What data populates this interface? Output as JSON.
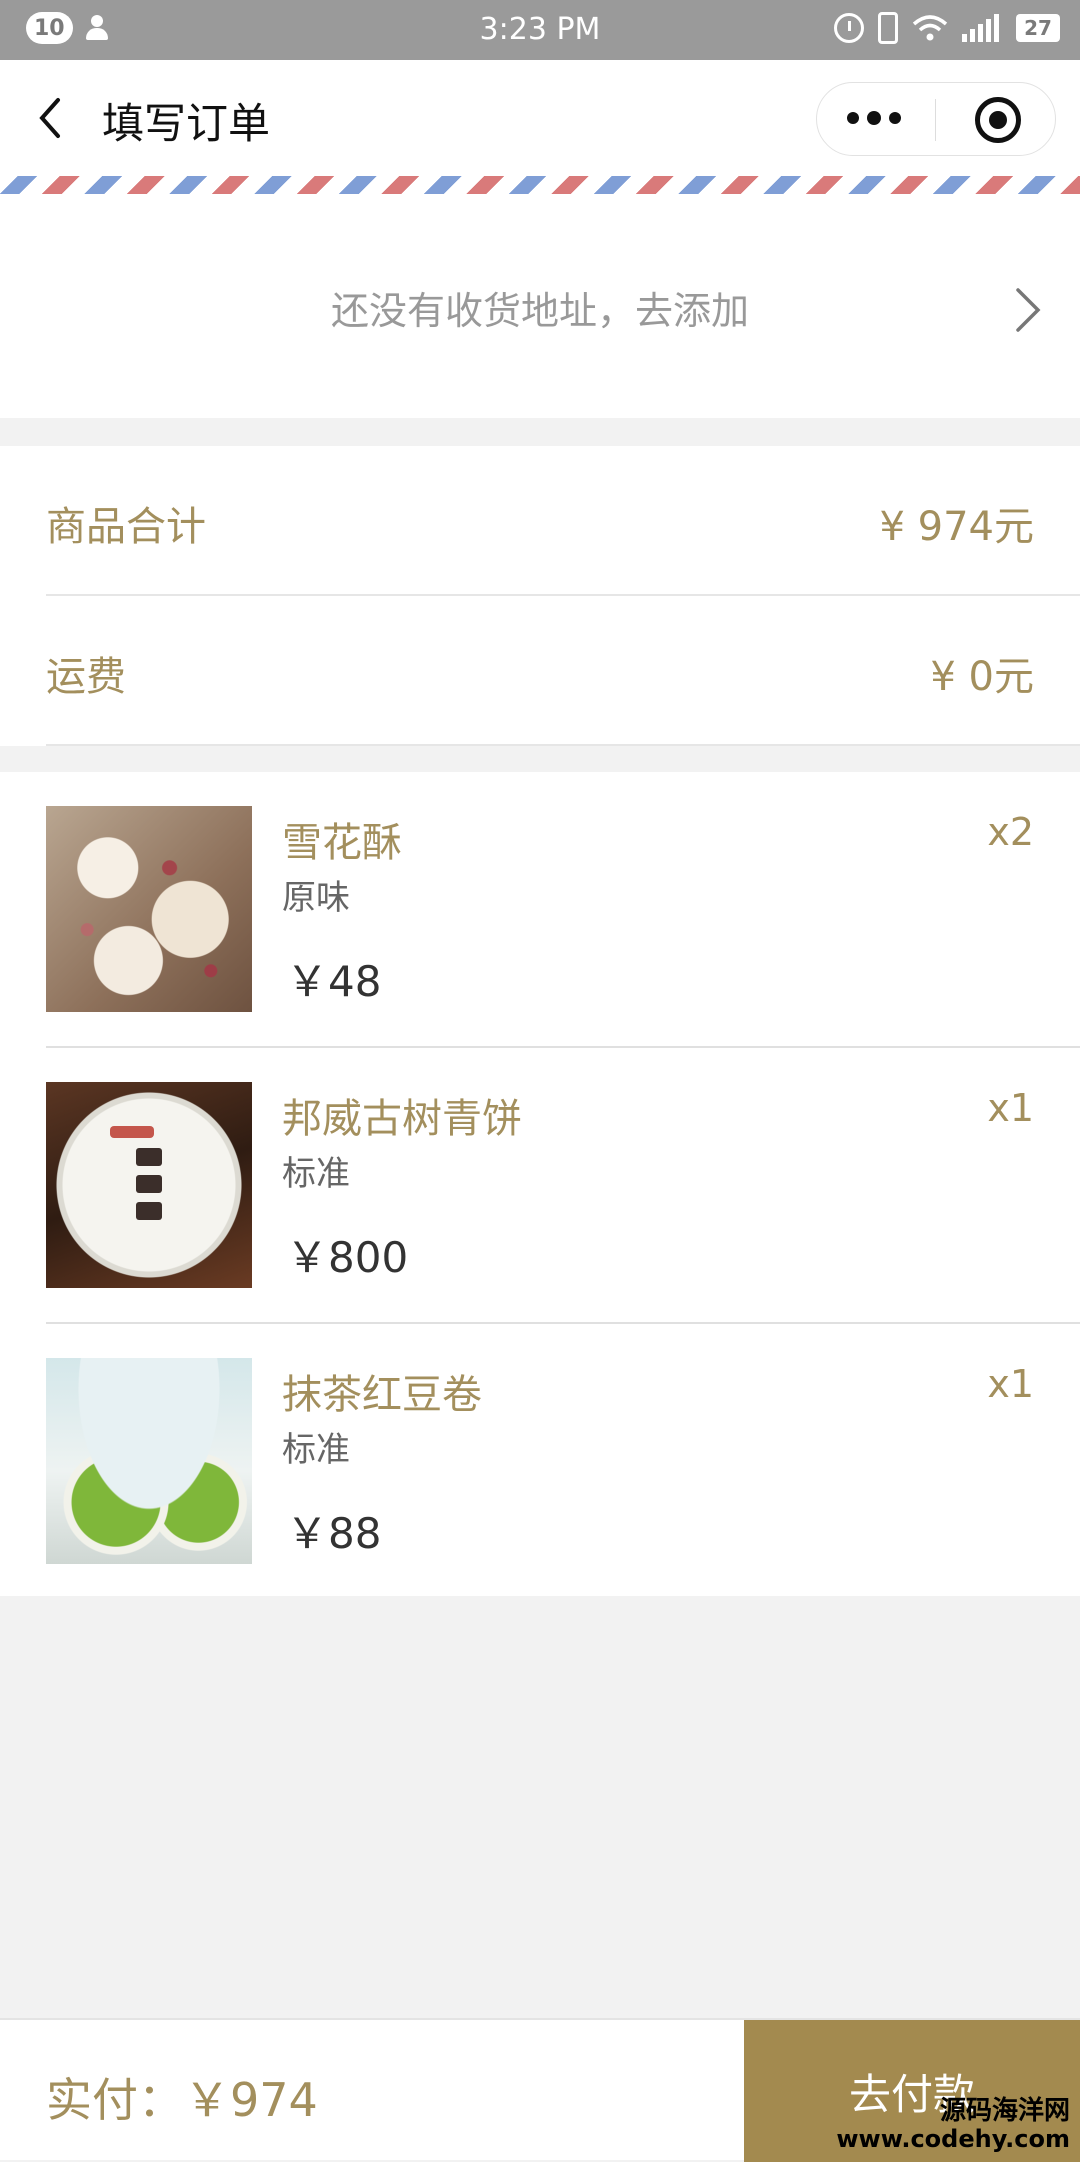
{
  "status_bar": {
    "notification_count": "10",
    "time": "3:23 PM",
    "battery": "27"
  },
  "nav": {
    "title": "填写订单"
  },
  "address": {
    "prompt": "还没有收货地址，去添加"
  },
  "summary": {
    "rows": [
      {
        "label": "商品合计",
        "value": "¥ 974元"
      },
      {
        "label": "运费",
        "value": "¥ 0元"
      }
    ]
  },
  "products": [
    {
      "name": "雪花酥",
      "spec": "原味",
      "price": "￥48",
      "qty": "x2"
    },
    {
      "name": "邦威古树青饼",
      "spec": "标准",
      "price": "￥800",
      "qty": "x1"
    },
    {
      "name": "抹茶红豆卷",
      "spec": "标准",
      "price": "￥88",
      "qty": "x1"
    }
  ],
  "footer": {
    "pay_label": "实付：￥974",
    "pay_button": "去付款"
  },
  "watermark": {
    "line1": "源码海洋网",
    "line2": "www.codehy.com"
  },
  "colors": {
    "accent_gold": "#a38f5d",
    "pay_button_bg": "#a38a4f"
  }
}
